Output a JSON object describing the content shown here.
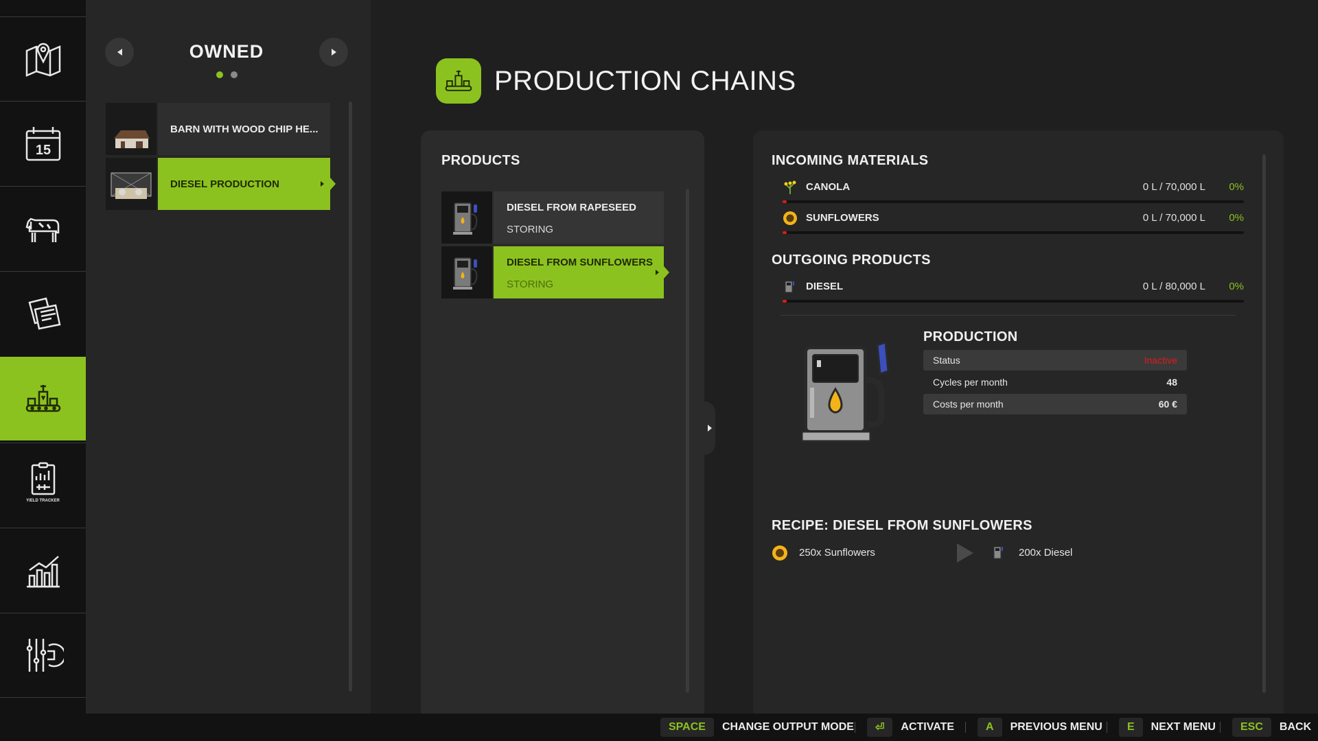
{
  "nav": {
    "items": [
      {
        "name": "map",
        "icon": "map-pin-icon",
        "caption": ""
      },
      {
        "name": "calendar",
        "icon": "calendar-icon",
        "caption": "",
        "day": "15"
      },
      {
        "name": "animals",
        "icon": "cow-icon",
        "caption": ""
      },
      {
        "name": "contracts",
        "icon": "documents-icon",
        "caption": ""
      },
      {
        "name": "production",
        "icon": "factory-icon",
        "caption": "",
        "active": true
      },
      {
        "name": "yield-tracker",
        "icon": "yield-tracker-icon",
        "caption": "YIELD TRACKER"
      },
      {
        "name": "statistics",
        "icon": "bar-chart-icon",
        "caption": ""
      },
      {
        "name": "settings",
        "icon": "settings-sliders-icon",
        "caption": ""
      }
    ]
  },
  "list": {
    "title": "OWNED",
    "pages": 2,
    "current_page": 1,
    "items": [
      {
        "label": "BARN WITH WOOD CHIP HE...",
        "active": false
      },
      {
        "label": "DIESEL PRODUCTION",
        "active": true
      }
    ]
  },
  "header": {
    "title": "PRODUCTION CHAINS"
  },
  "products": {
    "heading": "PRODUCTS",
    "items": [
      {
        "name": "DIESEL FROM RAPESEED",
        "state": "STORING",
        "active": false
      },
      {
        "name": "DIESEL FROM SUNFLOWERS",
        "state": "STORING",
        "active": true
      }
    ]
  },
  "incoming": {
    "heading": "INCOMING MATERIALS",
    "items": [
      {
        "name": "CANOLA",
        "icon": "canola-icon",
        "amount": "0 L / 70,000 L",
        "percent": "0%",
        "fill": 0.0
      },
      {
        "name": "SUNFLOWERS",
        "icon": "sunflower-icon",
        "amount": "0 L / 70,000 L",
        "percent": "0%",
        "fill": 0.0
      }
    ]
  },
  "outgoing": {
    "heading": "OUTGOING PRODUCTS",
    "items": [
      {
        "name": "DIESEL",
        "icon": "diesel-pump-icon",
        "amount": "0 L / 80,000 L",
        "percent": "0%",
        "fill": 0.0
      }
    ]
  },
  "production": {
    "heading": "PRODUCTION",
    "stats": [
      {
        "label": "Status",
        "value": "Inactive"
      },
      {
        "label": "Cycles per month",
        "value": "48"
      },
      {
        "label": "Costs per month",
        "value": "60 €"
      }
    ]
  },
  "recipe": {
    "heading": "RECIPE: DIESEL FROM SUNFLOWERS",
    "input": "250x Sunflowers",
    "output": "200x Diesel"
  },
  "hints": [
    {
      "key": "SPACE",
      "label": "CHANGE OUTPUT MODE"
    },
    {
      "key": "⏎",
      "label": "ACTIVATE"
    },
    {
      "key": "A",
      "label": "PREVIOUS MENU"
    },
    {
      "key": "E",
      "label": "NEXT MENU"
    },
    {
      "key": "ESC",
      "label": "BACK"
    }
  ],
  "colors": {
    "accent": "#8cc21f",
    "status_inactive": "#e01b1b",
    "background": "#1f1f1f"
  }
}
